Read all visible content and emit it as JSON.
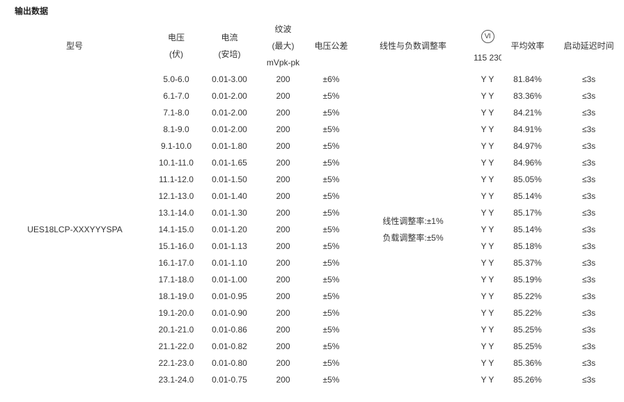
{
  "section_title": "输出数据",
  "headers": {
    "model": "型号",
    "voltage": [
      "电压",
      "(伏)"
    ],
    "current": [
      "电流",
      "(安培)"
    ],
    "ripple": [
      "纹波",
      "(最大)",
      "mVpk-pk"
    ],
    "tolerance": "电压公差",
    "regulation": "线性与负数调整率",
    "input_icon": "VI",
    "input_label": "115 230",
    "efficiency": "平均效率",
    "delay": "启动延迟时间"
  },
  "model_name": "UES18LCP-XXXYYYSPA",
  "regulation": {
    "line": "线性调整率:±1%",
    "load": "负载调整率:±5%"
  },
  "rows": [
    {
      "voltage": "5.0-6.0",
      "current": "0.01-3.00",
      "ripple": "200",
      "tolerance": "±6%",
      "input": "Y Y",
      "efficiency": "81.84%",
      "delay": "≤3s"
    },
    {
      "voltage": "6.1-7.0",
      "current": "0.01-2.00",
      "ripple": "200",
      "tolerance": "±5%",
      "input": "Y Y",
      "efficiency": "83.36%",
      "delay": "≤3s"
    },
    {
      "voltage": "7.1-8.0",
      "current": "0.01-2.00",
      "ripple": "200",
      "tolerance": "±5%",
      "input": "Y Y",
      "efficiency": "84.21%",
      "delay": "≤3s"
    },
    {
      "voltage": "8.1-9.0",
      "current": "0.01-2.00",
      "ripple": "200",
      "tolerance": "±5%",
      "input": "Y Y",
      "efficiency": "84.91%",
      "delay": "≤3s"
    },
    {
      "voltage": "9.1-10.0",
      "current": "0.01-1.80",
      "ripple": "200",
      "tolerance": "±5%",
      "input": "Y Y",
      "efficiency": "84.97%",
      "delay": "≤3s"
    },
    {
      "voltage": "10.1-11.0",
      "current": "0.01-1.65",
      "ripple": "200",
      "tolerance": "±5%",
      "input": "Y Y",
      "efficiency": "84.96%",
      "delay": "≤3s"
    },
    {
      "voltage": "11.1-12.0",
      "current": "0.01-1.50",
      "ripple": "200",
      "tolerance": "±5%",
      "input": "Y Y",
      "efficiency": "85.05%",
      "delay": "≤3s"
    },
    {
      "voltage": "12.1-13.0",
      "current": "0.01-1.40",
      "ripple": "200",
      "tolerance": "±5%",
      "input": "Y Y",
      "efficiency": "85.14%",
      "delay": "≤3s"
    },
    {
      "voltage": "13.1-14.0",
      "current": "0.01-1.30",
      "ripple": "200",
      "tolerance": "±5%",
      "input": "Y Y",
      "efficiency": "85.17%",
      "delay": "≤3s"
    },
    {
      "voltage": "14.1-15.0",
      "current": "0.01-1.20",
      "ripple": "200",
      "tolerance": "±5%",
      "input": "Y Y",
      "efficiency": "85.14%",
      "delay": "≤3s"
    },
    {
      "voltage": "15.1-16.0",
      "current": "0.01-1.13",
      "ripple": "200",
      "tolerance": "±5%",
      "input": "Y Y",
      "efficiency": "85.18%",
      "delay": "≤3s"
    },
    {
      "voltage": "16.1-17.0",
      "current": "0.01-1.10",
      "ripple": "200",
      "tolerance": "±5%",
      "input": "Y Y",
      "efficiency": "85.37%",
      "delay": "≤3s"
    },
    {
      "voltage": "17.1-18.0",
      "current": "0.01-1.00",
      "ripple": "200",
      "tolerance": "±5%",
      "input": "Y Y",
      "efficiency": "85.19%",
      "delay": "≤3s"
    },
    {
      "voltage": "18.1-19.0",
      "current": "0.01-0.95",
      "ripple": "200",
      "tolerance": "±5%",
      "input": "Y Y",
      "efficiency": "85.22%",
      "delay": "≤3s"
    },
    {
      "voltage": "19.1-20.0",
      "current": "0.01-0.90",
      "ripple": "200",
      "tolerance": "±5%",
      "input": "Y Y",
      "efficiency": "85.22%",
      "delay": "≤3s"
    },
    {
      "voltage": "20.1-21.0",
      "current": "0.01-0.86",
      "ripple": "200",
      "tolerance": "±5%",
      "input": "Y Y",
      "efficiency": "85.25%",
      "delay": "≤3s"
    },
    {
      "voltage": "21.1-22.0",
      "current": "0.01-0.82",
      "ripple": "200",
      "tolerance": "±5%",
      "input": "Y Y",
      "efficiency": "85.25%",
      "delay": "≤3s"
    },
    {
      "voltage": "22.1-23.0",
      "current": "0.01-0.80",
      "ripple": "200",
      "tolerance": "±5%",
      "input": "Y Y",
      "efficiency": "85.36%",
      "delay": "≤3s"
    },
    {
      "voltage": "23.1-24.0",
      "current": "0.01-0.75",
      "ripple": "200",
      "tolerance": "±5%",
      "input": "Y Y",
      "efficiency": "85.26%",
      "delay": "≤3s"
    }
  ]
}
